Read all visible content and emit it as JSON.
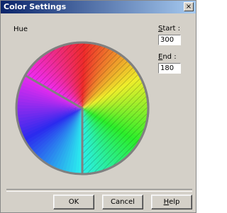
{
  "window": {
    "title": "Color Settings",
    "close_glyph": "×"
  },
  "hue_label": "Hue",
  "start": {
    "label_mnemonic": "S",
    "label_rest": "tart :",
    "value": "300"
  },
  "end": {
    "label_mnemonic": "E",
    "label_rest": "nd :",
    "value": "180"
  },
  "buttons": {
    "ok": "OK",
    "cancel": "Cancel",
    "help_mnemonic": "H",
    "help_rest": "elp"
  },
  "hue_wheel": {
    "start_degrees": 300,
    "end_degrees": 180,
    "highlight_color": "#808080"
  }
}
